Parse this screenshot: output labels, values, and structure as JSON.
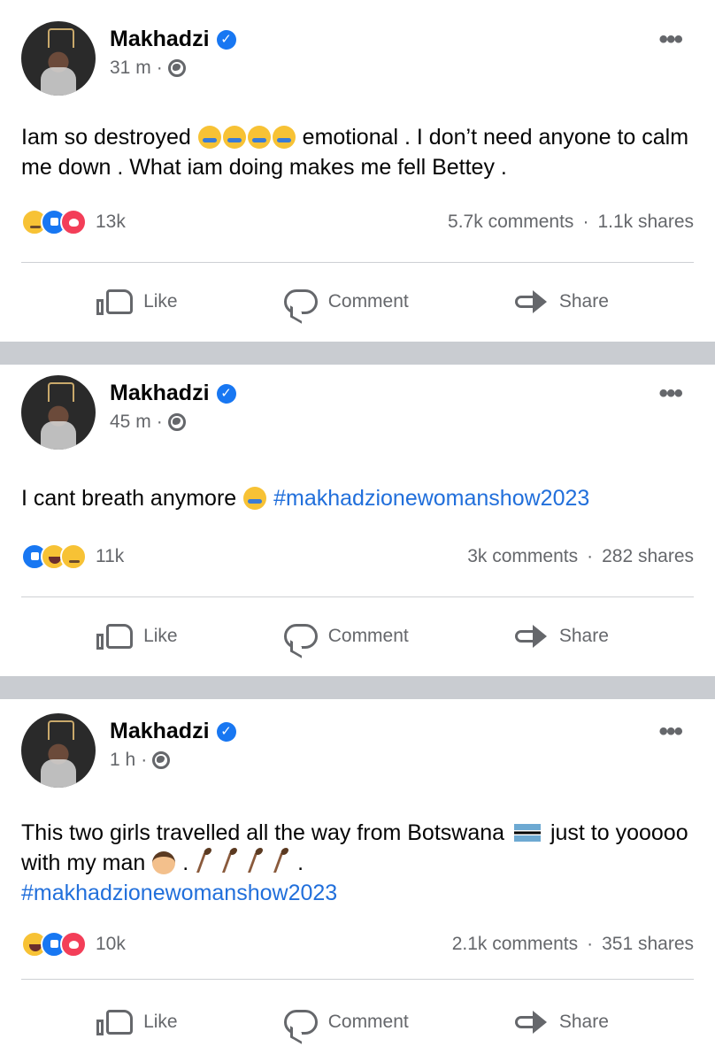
{
  "posts": [
    {
      "author": "Makhadzi",
      "time": "31 m",
      "text_parts": [
        "Iam so destroyed",
        "emotional  . I don’t need anyone to calm me down . What iam doing makes me fell Bettey ."
      ],
      "hashtag": "",
      "reaction_count": "13k",
      "comments": "5.7k comments",
      "shares": "1.1k shares"
    },
    {
      "author": "Makhadzi",
      "time": "45 m",
      "text_parts": [
        "I cant breath anymore",
        ""
      ],
      "hashtag": "#makhadzionewomanshow2023",
      "reaction_count": "11k",
      "comments": "3k comments",
      "shares": "282 shares"
    },
    {
      "author": "Makhadzi",
      "time": "1 h",
      "text_parts": [
        "This two girls travelled all the way from Botswana",
        "just to yooooo with my man",
        "."
      ],
      "hashtag": "#makhadzionewomanshow2023",
      "reaction_count": "10k",
      "comments": "2.1k comments",
      "shares": "351 shares"
    }
  ],
  "actions": {
    "like": "Like",
    "comment": "Comment",
    "share": "Share"
  },
  "separator_dot": "·",
  "colors": {
    "link": "#216fdb",
    "verified": "#1877f2",
    "meta": "#65676b",
    "separator": "#c9ccd1"
  },
  "icons": [
    "more-icon",
    "globe-icon",
    "verified-icon",
    "like-icon",
    "comment-icon",
    "share-icon"
  ]
}
